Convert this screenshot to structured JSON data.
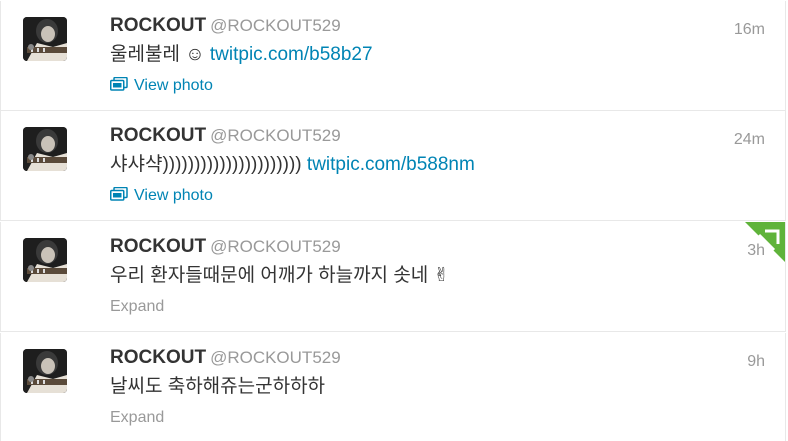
{
  "tweets": [
    {
      "name": "ROCKOUT",
      "handle": "@ROCKOUT529",
      "time": "16m",
      "text": "울레불레 ☺ ",
      "link": "twitpic.com/b58b27",
      "action": "View photo"
    },
    {
      "name": "ROCKOUT",
      "handle": "@ROCKOUT529",
      "time": "24m",
      "text": "샤샤샥)))))))))))))))))))))) ",
      "link": "twitpic.com/b588nm",
      "action": "View photo"
    },
    {
      "name": "ROCKOUT",
      "handle": "@ROCKOUT529",
      "time": "3h",
      "text": "우리 환자들때문에 어깨가 하늘까지 솟네 ✌",
      "action": "Expand"
    },
    {
      "name": "ROCKOUT",
      "handle": "@ROCKOUT529",
      "time": "9h",
      "text": "날씨도 축하해쥬는군하하하",
      "action": "Expand"
    }
  ],
  "colors": {
    "link": "#0084b4",
    "name": "#333333",
    "meta": "#999999",
    "retweet_corner": "#5fb33a"
  },
  "icons": {
    "photo": "photo-icon",
    "retweet_corner": "retweet-corner-icon"
  }
}
